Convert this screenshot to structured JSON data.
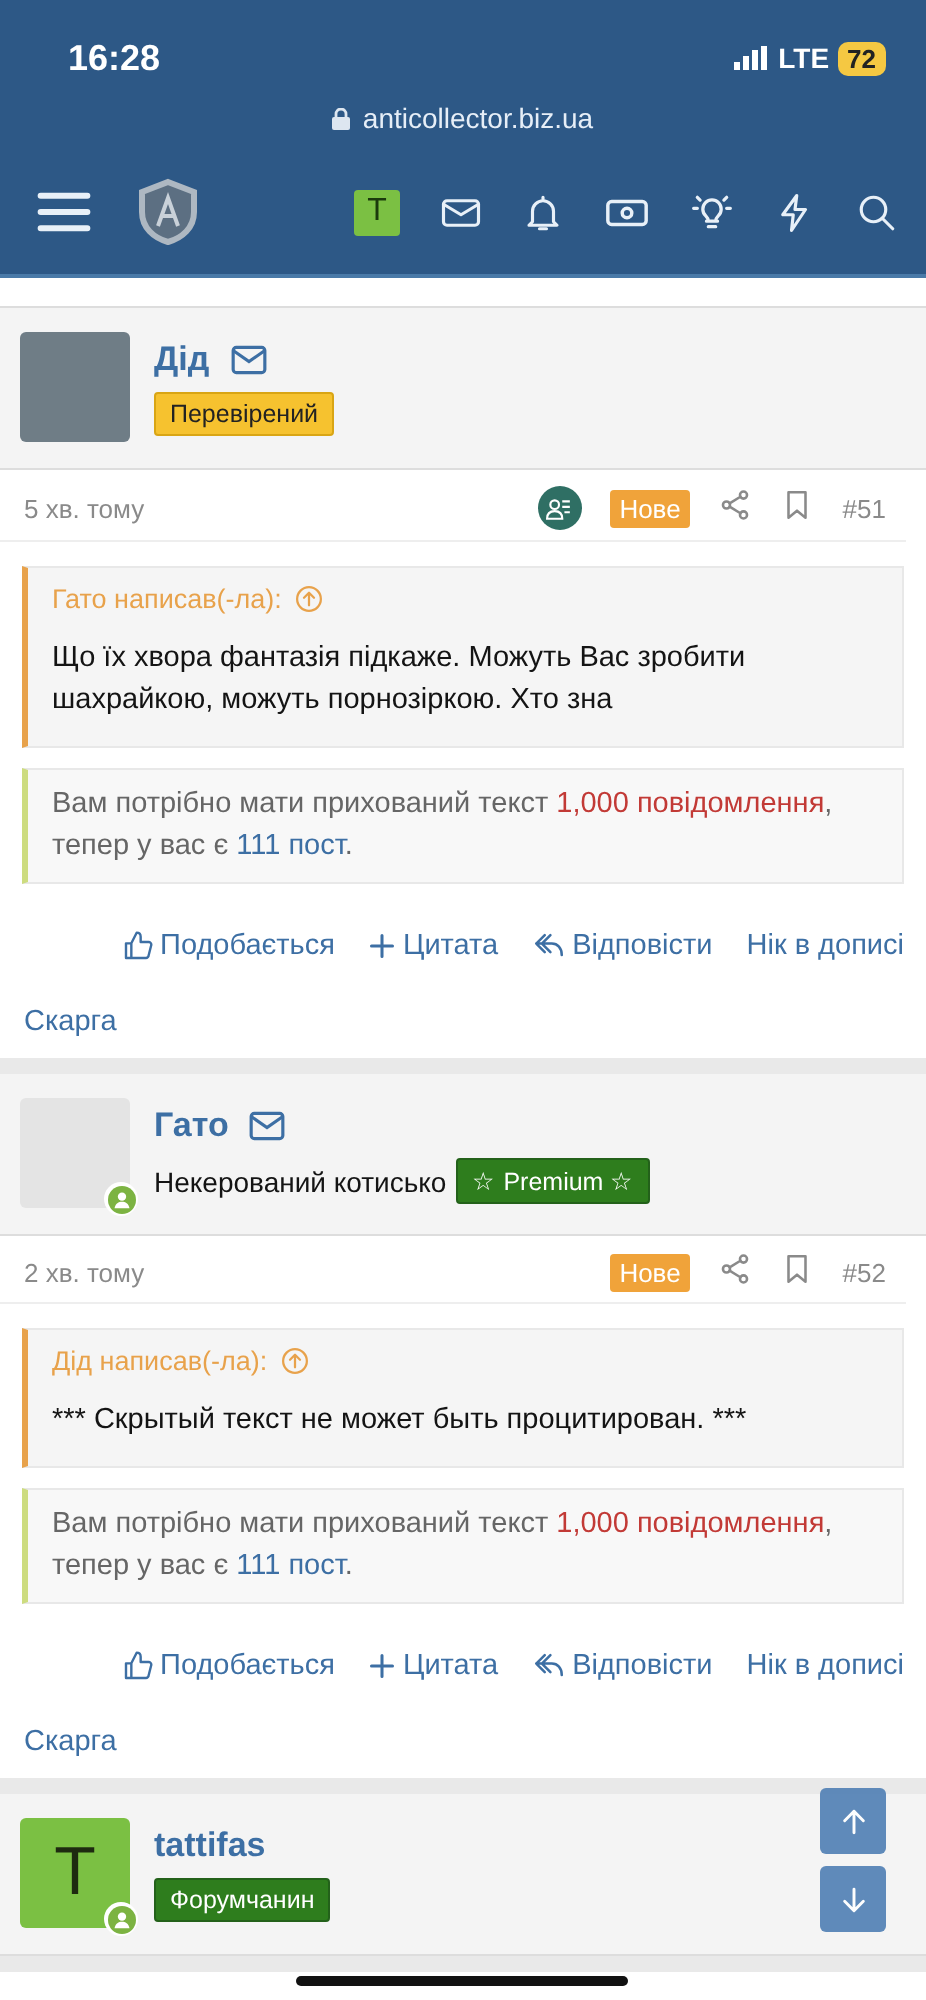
{
  "status_bar": {
    "time": "16:28",
    "network": "LTE",
    "battery": "72",
    "url": "anticollector.biz.ua"
  },
  "nav": {
    "user_letter": "T"
  },
  "posts": [
    {
      "author": "Дід",
      "avatar": {
        "kind": "photo"
      },
      "online": false,
      "badge": {
        "text": "Перевірений",
        "kind": "verified"
      },
      "time": "5 хв. тому",
      "group_icon": true,
      "new_label": "Нове",
      "number": "#51",
      "quote": {
        "attribution": "Гато написав(-ла):",
        "text": "Що їх хвора фантазія підкаже. Можуть Вас зробити шахрайкою, можуть порнозіркою. Хто зна"
      },
      "notice": [
        {
          "text": "Вам потрібно мати прихований текст ",
          "kind": "plain"
        },
        {
          "text": "1,000 повідомлення",
          "kind": "requirement"
        },
        {
          "text": ", тепер у вас є ",
          "kind": "plain"
        },
        {
          "text": "111 пост",
          "kind": "count"
        },
        {
          "text": ".",
          "kind": "plain"
        }
      ],
      "actions": [
        {
          "label": "Подобається",
          "kind": "like"
        },
        {
          "label": "Цитата",
          "kind": "quote"
        },
        {
          "label": "Відповісти",
          "kind": "reply"
        },
        {
          "label": "Нік в дописі",
          "kind": "mention"
        }
      ],
      "report": "Скарга"
    },
    {
      "author": "Гато",
      "avatar": {
        "kind": "image"
      },
      "online": true,
      "user_title": "Некерований котисько",
      "badge": {
        "text": "☆ Premium ☆",
        "kind": "premium"
      },
      "time": "2 хв. тому",
      "group_icon": false,
      "new_label": "Нове",
      "number": "#52",
      "quote": {
        "attribution": "Дід написав(-ла):",
        "text": "*** Скрытый текст не может быть процитирован. ***"
      },
      "notice": [
        {
          "text": "Вам потрібно мати прихований текст ",
          "kind": "plain"
        },
        {
          "text": "1,000 повідомлення",
          "kind": "requirement"
        },
        {
          "text": ", тепер у вас є ",
          "kind": "plain"
        },
        {
          "text": "111 пост",
          "kind": "count"
        },
        {
          "text": ".",
          "kind": "plain"
        }
      ],
      "actions": [
        {
          "label": "Подобається",
          "kind": "like"
        },
        {
          "label": "Цитата",
          "kind": "quote"
        },
        {
          "label": "Відповісти",
          "kind": "reply"
        },
        {
          "label": "Нік в дописі",
          "kind": "mention"
        }
      ],
      "report": "Скарга"
    },
    {
      "author": "tattifas",
      "avatar": {
        "kind": "letter",
        "letter": "T"
      },
      "online": true,
      "badge": {
        "text": "Форумчанин",
        "kind": "member"
      }
    }
  ]
}
